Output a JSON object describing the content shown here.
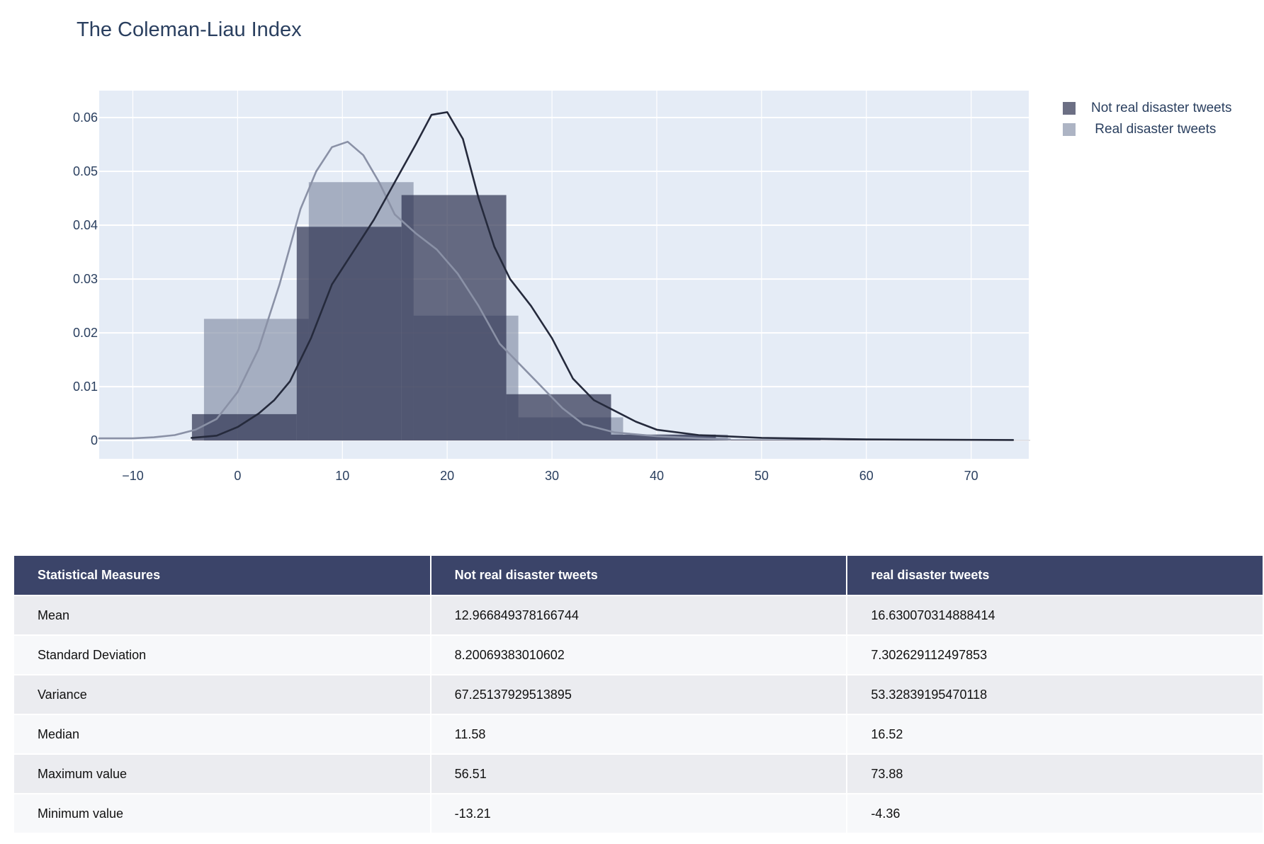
{
  "chart_data": {
    "type": "histogram",
    "title": "The Coleman-Liau Index",
    "xlim": [
      -13.21,
      75.5
    ],
    "ylim": [
      -0.0034,
      0.065
    ],
    "x_ticks": [
      -10,
      0,
      10,
      20,
      30,
      40,
      50,
      60,
      70
    ],
    "x_tick_labels": [
      "−10",
      "0",
      "10",
      "20",
      "30",
      "40",
      "50",
      "60",
      "70"
    ],
    "y_ticks": [
      0,
      0.01,
      0.02,
      0.03,
      0.04,
      0.05,
      0.06
    ],
    "y_tick_labels": [
      "0",
      "0.01",
      "0.02",
      "0.03",
      "0.04",
      "0.05",
      "0.06"
    ],
    "grid": true,
    "legend_position": "top-right",
    "series": [
      {
        "name": "Not real disaster tweets",
        "color": "#2e3250",
        "opacity": 0.7,
        "bins": [
          {
            "x0": -4.36,
            "x1": 5.64,
            "y": 0.0049
          },
          {
            "x0": 5.64,
            "x1": 15.64,
            "y": 0.0397
          },
          {
            "x0": 15.64,
            "x1": 25.64,
            "y": 0.0456
          },
          {
            "x0": 25.64,
            "x1": 35.64,
            "y": 0.0086
          },
          {
            "x0": 35.64,
            "x1": 45.64,
            "y": 0.0011
          },
          {
            "x0": 45.64,
            "x1": 55.64,
            "y": 0.0002
          },
          {
            "x0": 55.64,
            "x1": 65.64,
            "y": 0.0001
          },
          {
            "x0": 65.64,
            "x1": 75.64,
            "y": 5e-05
          }
        ],
        "kde": [
          [
            -4.4,
            0.0005
          ],
          [
            -2,
            0.0009
          ],
          [
            0,
            0.0025
          ],
          [
            2,
            0.005
          ],
          [
            3.5,
            0.0075
          ],
          [
            5,
            0.011
          ],
          [
            7,
            0.019
          ],
          [
            9,
            0.029
          ],
          [
            11,
            0.035
          ],
          [
            13,
            0.041
          ],
          [
            15,
            0.048
          ],
          [
            17,
            0.055
          ],
          [
            18.5,
            0.0605
          ],
          [
            20,
            0.061
          ],
          [
            21.5,
            0.056
          ],
          [
            23,
            0.045
          ],
          [
            24.5,
            0.036
          ],
          [
            26,
            0.03
          ],
          [
            28,
            0.025
          ],
          [
            30,
            0.019
          ],
          [
            32,
            0.0115
          ],
          [
            34,
            0.0075
          ],
          [
            36,
            0.0055
          ],
          [
            38,
            0.0035
          ],
          [
            40,
            0.002
          ],
          [
            44,
            0.001
          ],
          [
            50,
            0.0005
          ],
          [
            60,
            0.0002
          ],
          [
            74,
            0.0001
          ]
        ]
      },
      {
        "name": " Real disaster tweets",
        "color": "#8a94ab",
        "opacity": 0.7,
        "bins": [
          {
            "x0": -3.21,
            "x1": 6.79,
            "y": 0.0226
          },
          {
            "x0": 6.79,
            "x1": 16.79,
            "y": 0.048
          },
          {
            "x0": 16.79,
            "x1": 26.79,
            "y": 0.0232
          },
          {
            "x0": 26.79,
            "x1": 36.79,
            "y": 0.0043
          },
          {
            "x0": 36.79,
            "x1": 46.79,
            "y": 0.0011
          }
        ],
        "kde": [
          [
            -13.2,
            0.0004
          ],
          [
            -10,
            0.0004
          ],
          [
            -8,
            0.0006
          ],
          [
            -6,
            0.001
          ],
          [
            -4,
            0.002
          ],
          [
            -2,
            0.004
          ],
          [
            0,
            0.009
          ],
          [
            2,
            0.017
          ],
          [
            4,
            0.029
          ],
          [
            6,
            0.043
          ],
          [
            7.5,
            0.05
          ],
          [
            9,
            0.0545
          ],
          [
            10.5,
            0.0555
          ],
          [
            12,
            0.053
          ],
          [
            13.5,
            0.048
          ],
          [
            15,
            0.042
          ],
          [
            17,
            0.0385
          ],
          [
            19,
            0.0355
          ],
          [
            21,
            0.031
          ],
          [
            23,
            0.025
          ],
          [
            25,
            0.018
          ],
          [
            27,
            0.014
          ],
          [
            29,
            0.01
          ],
          [
            31,
            0.006
          ],
          [
            33,
            0.003
          ],
          [
            36,
            0.0015
          ],
          [
            40,
            0.0008
          ],
          [
            44,
            0.0004
          ],
          [
            47,
            0.0002
          ]
        ]
      }
    ]
  },
  "table": {
    "headers": [
      "Statistical Measures",
      "Not real disaster tweets",
      "real disaster tweets"
    ],
    "rows": [
      [
        "Mean",
        "12.966849378166744",
        "16.630070314888414"
      ],
      [
        "Standard Deviation",
        "8.20069383010602",
        "7.302629112497853"
      ],
      [
        "Variance",
        "67.25137929513895",
        "53.32839195470118"
      ],
      [
        "Median",
        "11.58",
        "16.52"
      ],
      [
        "Maximum value",
        "56.51",
        "73.88"
      ],
      [
        "Minimum value",
        "-13.21",
        "-4.36"
      ]
    ]
  },
  "colors": {
    "plot_background": "#e5ecf6",
    "header_background": "#3b4469"
  }
}
